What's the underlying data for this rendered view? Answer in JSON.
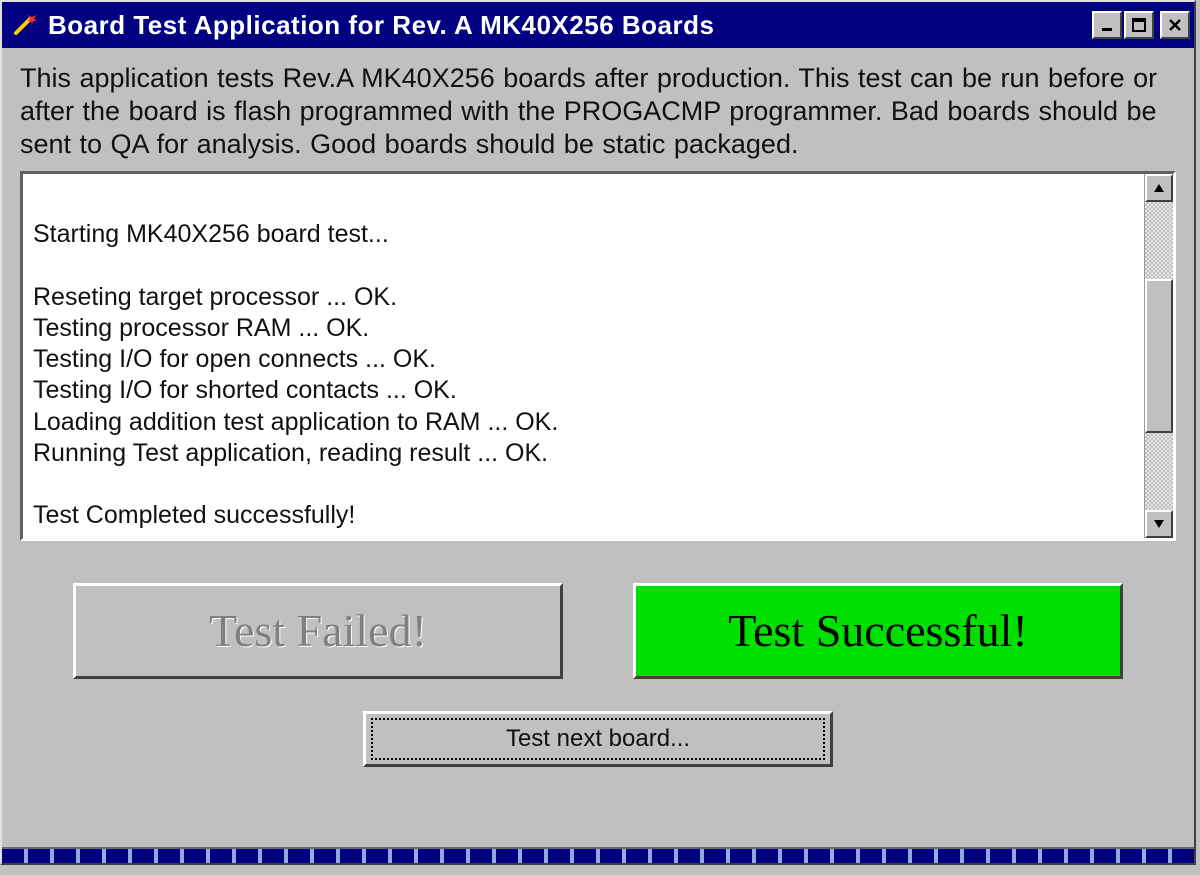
{
  "window": {
    "title": "Board Test Application for Rev. A MK40X256 Boards"
  },
  "description": "This application tests Rev.A MK40X256 boards after production. This test can be run before or after the board is flash programmed with the PROGACMP programmer. Bad boards should be sent to QA for analysis.  Good boards should be static packaged.",
  "log": {
    "lines": [
      "",
      "Starting MK40X256 board test...",
      "",
      "Reseting target processor ... OK.",
      "Testing processor RAM ... OK.",
      "Testing I/O for open connects ... OK.",
      "Testing I/O for shorted contacts ... OK.",
      "Loading addition test application to RAM ... OK.",
      "Running Test application, reading result ... OK.",
      "",
      "Test Completed successfully!"
    ]
  },
  "status": {
    "fail_label": "Test Failed!",
    "success_label": "Test Successful!",
    "result": "success"
  },
  "actions": {
    "next_label": "Test next board..."
  }
}
